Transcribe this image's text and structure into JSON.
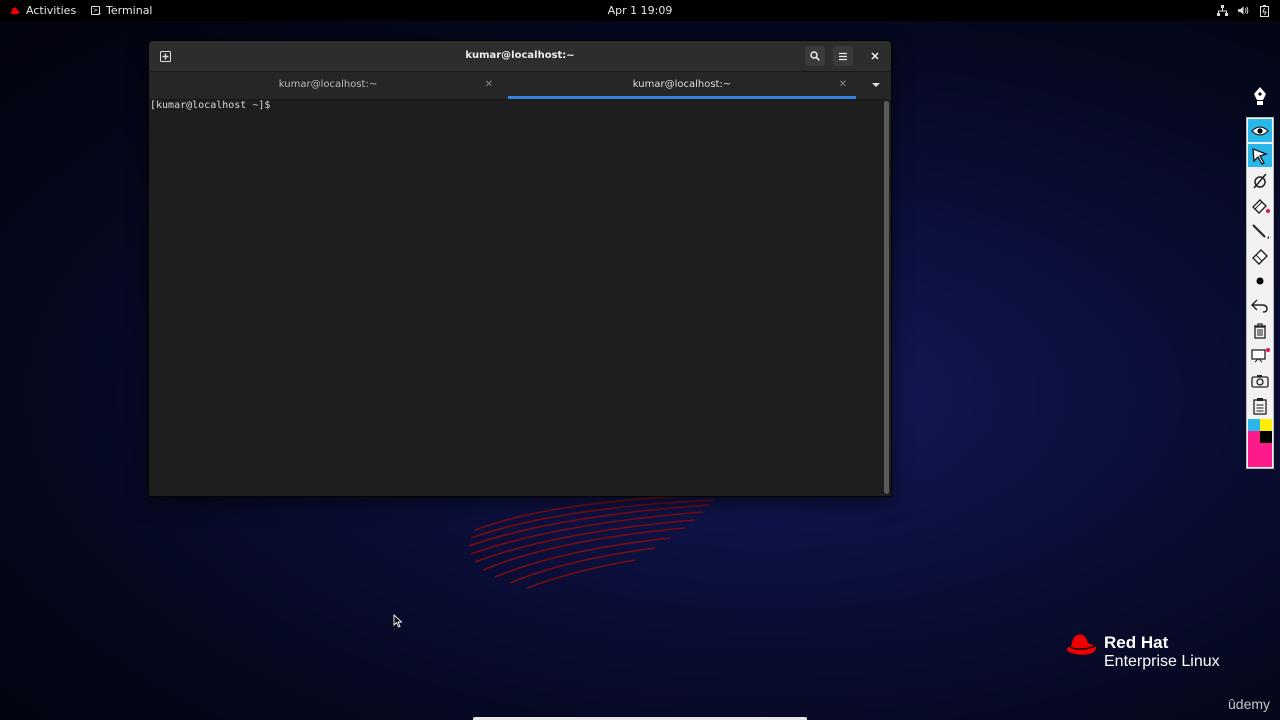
{
  "topbar": {
    "activities_label": "Activities",
    "app_label": "Terminal",
    "clock": "Apr 1  19:09",
    "tray_icons": [
      "network-icon",
      "volume-icon",
      "battery-icon"
    ]
  },
  "terminal": {
    "window_title": "kumar@localhost:~",
    "tabs": [
      {
        "label": "kumar@localhost:~",
        "active": false
      },
      {
        "label": "kumar@localhost:~",
        "active": true
      }
    ],
    "prompt": "[kumar@localhost ~]$ ",
    "accent_color": "#3584e4"
  },
  "annotation_toolbar": {
    "tools": [
      "pen-tip-icon",
      "eye-icon",
      "pointer-icon",
      "hide-strokes-icon",
      "highlighter-icon",
      "line-icon",
      "eraser-icon",
      "dot-icon",
      "undo-icon",
      "trash-icon",
      "whiteboard-icon",
      "camera-icon",
      "clipboard-icon"
    ],
    "active_tools": [
      "eye-icon",
      "pointer-icon"
    ],
    "palette_colors": [
      "#29b6e8",
      "#ffee00",
      "#ff1a8c",
      "#000000"
    ]
  },
  "branding": {
    "logo_line1": "Red Hat",
    "logo_line2": "Enterprise Linux",
    "logo_color": "#ee0000",
    "watermark": "ûdemy"
  }
}
